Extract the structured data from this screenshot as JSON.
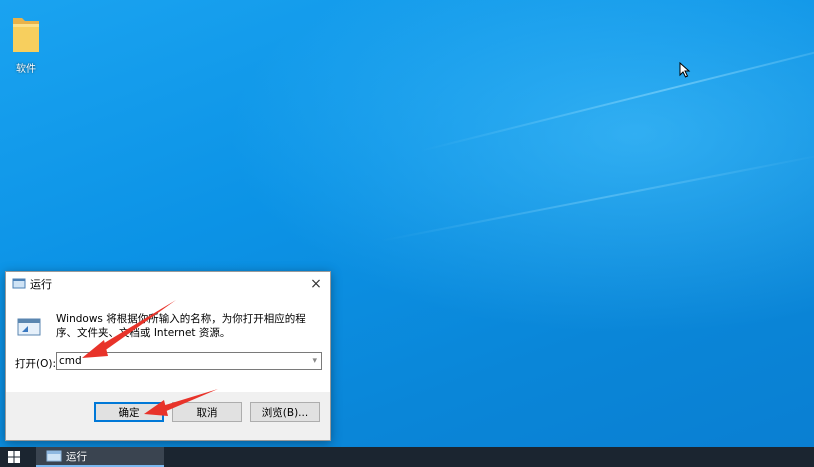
{
  "desktop": {
    "icons": [
      {
        "label": "软件"
      }
    ]
  },
  "run_dialog": {
    "title": "运行",
    "close_glyph": "×",
    "description": "Windows 将根据你所输入的名称，为你打开相应的程序、文件夹、文档或 Internet 资源。",
    "open_label": "打开(O):",
    "open_value": "cmd",
    "ok_label": "确定",
    "cancel_label": "取消",
    "browse_label": "浏览(B)..."
  },
  "taskbar": {
    "items": [
      {
        "label": "运行",
        "icon": "run-icon"
      }
    ]
  },
  "colors": {
    "accent": "#0078d7",
    "arrow": "#e8332a",
    "taskbar": "#1b2530"
  }
}
